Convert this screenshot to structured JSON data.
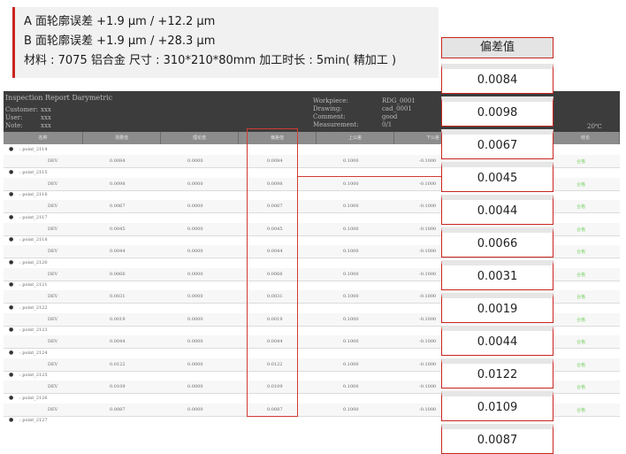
{
  "info": {
    "line_a": "A 面轮廓误差 +1.9 µm / +12.2 µm",
    "line_b": "B 面轮廓误差 +1.9 µm / +28.3 µm",
    "line_c": "材料 : 7075 铝合金  尺寸 : 310*210*80mm   加工时长 : 5min( 精加工 )"
  },
  "report": {
    "title": "Inspection Report Darymetric",
    "left_labels": [
      "Customer:",
      "User:",
      "Note:"
    ],
    "left_values": [
      "xxx",
      "xxx",
      "xxx"
    ],
    "right_labels": [
      "Workpiece:",
      "Drawing:",
      "Comment:",
      "Measurement:"
    ],
    "right_values": [
      "RDG_0001",
      "cad_0001",
      "good",
      "0/1"
    ],
    "temperature": "20℃",
    "columns": [
      "名称",
      "测量值",
      "理论值",
      "偏差值",
      "上公差",
      "下公差",
      "结论"
    ],
    "marker": "●",
    "rows": [
      {
        "name": ": point_2114",
        "label": "DEV",
        "measured": "0.0084",
        "nominal": "0.0000",
        "dev": "0.0084",
        "upper": "0.1000",
        "lower": "-0.1000",
        "result": "合格"
      },
      {
        "name": ": point_2115",
        "label": "DEV",
        "measured": "0.0098",
        "nominal": "0.0000",
        "dev": "0.0098",
        "upper": "0.1000",
        "lower": "-0.1000",
        "result": "合格"
      },
      {
        "name": ": point_2116",
        "label": "DEV",
        "measured": "0.0067",
        "nominal": "0.0000",
        "dev": "0.0067",
        "upper": "0.1000",
        "lower": "-0.1000",
        "result": "合格"
      },
      {
        "name": ": point_2117",
        "label": "DEV",
        "measured": "0.0045",
        "nominal": "0.0000",
        "dev": "0.0045",
        "upper": "0.1000",
        "lower": "-0.1000",
        "result": "合格"
      },
      {
        "name": ": point_2118",
        "label": "DEV",
        "measured": "0.0044",
        "nominal": "0.0000",
        "dev": "0.0044",
        "upper": "0.1000",
        "lower": "-0.1000",
        "result": "合格"
      },
      {
        "name": ": point_2120",
        "label": "DEV",
        "measured": "0.0066",
        "nominal": "0.0000",
        "dev": "0.0066",
        "upper": "0.1000",
        "lower": "-0.1000",
        "result": "合格"
      },
      {
        "name": ": point_2121",
        "label": "DEV",
        "measured": "0.0031",
        "nominal": "0.0000",
        "dev": "0.0031",
        "upper": "0.1000",
        "lower": "-0.1000",
        "result": "合格"
      },
      {
        "name": ": point_2122",
        "label": "DEV",
        "measured": "0.0019",
        "nominal": "0.0000",
        "dev": "0.0019",
        "upper": "0.1000",
        "lower": "-0.1000",
        "result": "合格"
      },
      {
        "name": ": point_2123",
        "label": "DEV",
        "measured": "0.0044",
        "nominal": "0.0000",
        "dev": "0.0044",
        "upper": "0.1000",
        "lower": "-0.1000",
        "result": "合格"
      },
      {
        "name": ": point_2124",
        "label": "DEV",
        "measured": "0.0122",
        "nominal": "0.0000",
        "dev": "0.0122",
        "upper": "0.1000",
        "lower": "-0.1000",
        "result": "合格"
      },
      {
        "name": ": point_2125",
        "label": "DEV",
        "measured": "0.0109",
        "nominal": "0.0000",
        "dev": "0.0109",
        "upper": "0.1000",
        "lower": "-0.1000",
        "result": "合格"
      },
      {
        "name": ": point_2126",
        "label": "DEV",
        "measured": "0.0087",
        "nominal": "0.0000",
        "dev": "0.0087",
        "upper": "0.1000",
        "lower": "-0.1000",
        "result": "合格"
      }
    ],
    "last_row_name": ": point_2127"
  },
  "callout": {
    "header": "偏差值",
    "values": [
      "0.0084",
      "0.0098",
      "0.0067",
      "0.0045",
      "0.0044",
      "0.0066",
      "0.0031",
      "0.0019",
      "0.0044",
      "0.0122",
      "0.0109",
      "0.0087"
    ]
  },
  "colors": {
    "accent_red": "#c8261f",
    "pass_green": "#7fd36b",
    "header_dark": "#3c3c3c"
  }
}
